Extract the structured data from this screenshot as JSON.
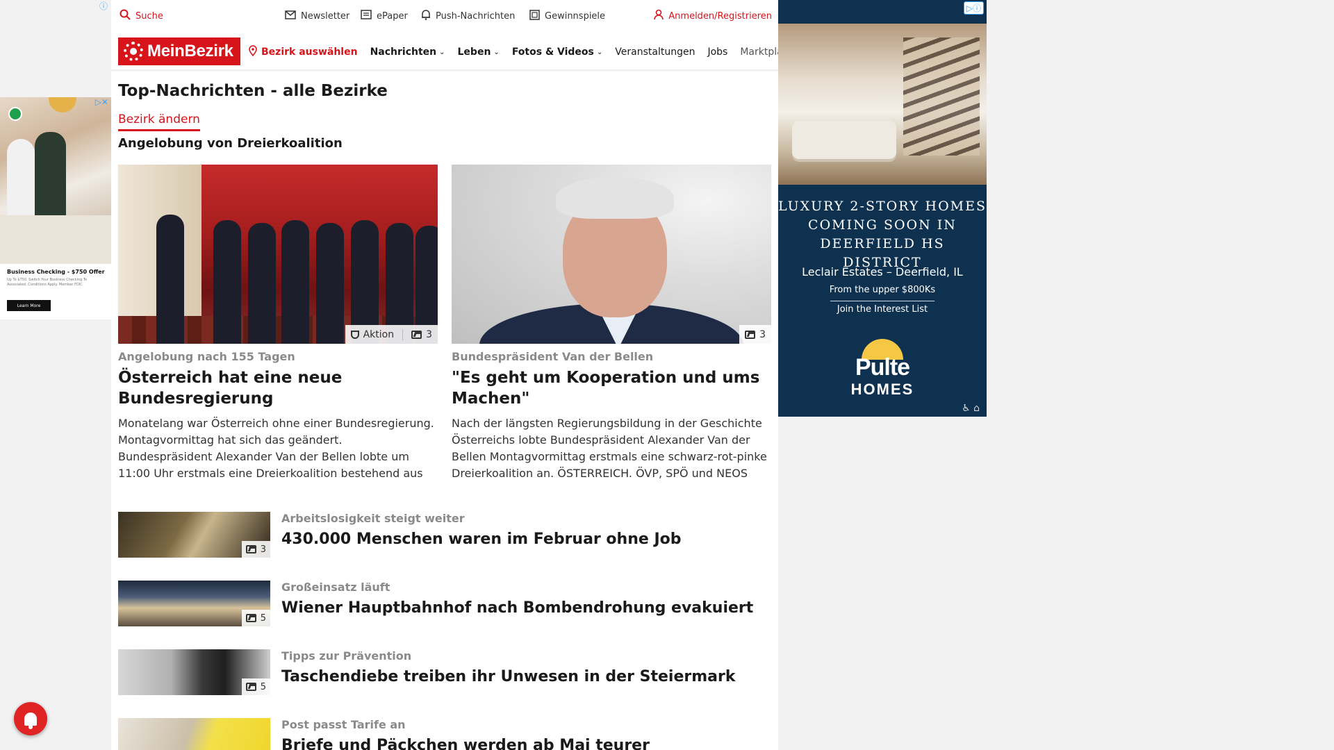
{
  "topbar": {
    "search": "Suche",
    "newsletter": "Newsletter",
    "epaper": "ePaper",
    "push": "Push-Nachrichten",
    "gewinnspiele": "Gewinnspiele",
    "login": "Anmelden/Registrieren"
  },
  "nav": {
    "logo": "MeinBezirk",
    "bezirk": "Bezirk auswählen",
    "items": [
      {
        "label": "Nachrichten"
      },
      {
        "label": "Leben"
      },
      {
        "label": "Fotos & Videos"
      }
    ],
    "veranstaltungen": "Veranstaltungen",
    "jobs": "Jobs",
    "marktplatz": "Marktplatz"
  },
  "page": {
    "title": "Top-Nachrichten - alle Bezirke",
    "change_bezirk": "Bezirk ändern",
    "topic": "Angelobung von Dreierkoalition"
  },
  "cards": [
    {
      "kicker": "Angelobung nach 155 Tagen",
      "headline": "Österreich hat eine neue Bundesregierung",
      "teaser": "Monatelang war Österreich ohne einer Bundesregierung. Montagvormittag hat sich das geändert. Bundespräsident Alexander Van der Bellen lobte um 11:00 Uhr erstmals eine Dreierkoalition bestehend aus ÖVP, SP...",
      "badge_label": "Aktion",
      "image_count": "3"
    },
    {
      "kicker": "Bundespräsident Van der Bellen",
      "headline": "\"Es geht um Kooperation und ums Machen\"",
      "teaser": "Nach der längsten Regierungsbildung in der Geschichte Österreichs lobte Bundespräsident Alexander Van der Bellen Montagvormittag erstmals eine schwarz-rot-pinke Dreierkoalition an. ÖSTERREICH. ÖVP, SPÖ und NEOS bilde...",
      "image_count": "3"
    }
  ],
  "list": [
    {
      "kicker": "Arbeitslosigkeit steigt weiter",
      "headline": "430.000 Menschen waren im Februar ohne Job",
      "image_count": "3"
    },
    {
      "kicker": "Großeinsatz läuft",
      "headline": "Wiener Hauptbahnhof nach Bombendrohung evakuiert",
      "image_count": "5"
    },
    {
      "kicker": "Tipps zur Prävention",
      "headline": "Taschendiebe treiben ihr Unwesen in der Steiermark",
      "image_count": "5"
    },
    {
      "kicker": "Post passt Tarife an",
      "headline": "Briefe und Päckchen werden ab Mai teurer",
      "image_count": ""
    }
  ],
  "ad_right": {
    "headline": "LUXURY 2-STORY HOMES COMING SOON IN DEERFIELD HS DISTRICT",
    "location": "Leclair Estates – Deerfield, IL",
    "price": "From the upper $800Ks",
    "cta": "Join the Interest List",
    "brand": "Pulte",
    "brand_sub": "HOMES"
  },
  "ad_left": {
    "title": "Business Checking - $750 Offer",
    "fine": "Up To $750. Switch Your Business Checking To Associated. Conditions Apply. Member FDIC",
    "cta": "Learn More"
  },
  "colors": {
    "brand_red": "#d7141a",
    "ad_navy": "#0f3150",
    "kicker_gray": "#8a8a8a"
  },
  "icons": [
    "search-icon",
    "mail-icon",
    "epaper-icon",
    "bell-icon",
    "gift-icon",
    "user-icon",
    "location-pin-icon",
    "chevron-down-icon",
    "trophy-icon",
    "image-gallery-icon",
    "notification-bell-icon",
    "info-icon",
    "ad-choices-icon"
  ]
}
